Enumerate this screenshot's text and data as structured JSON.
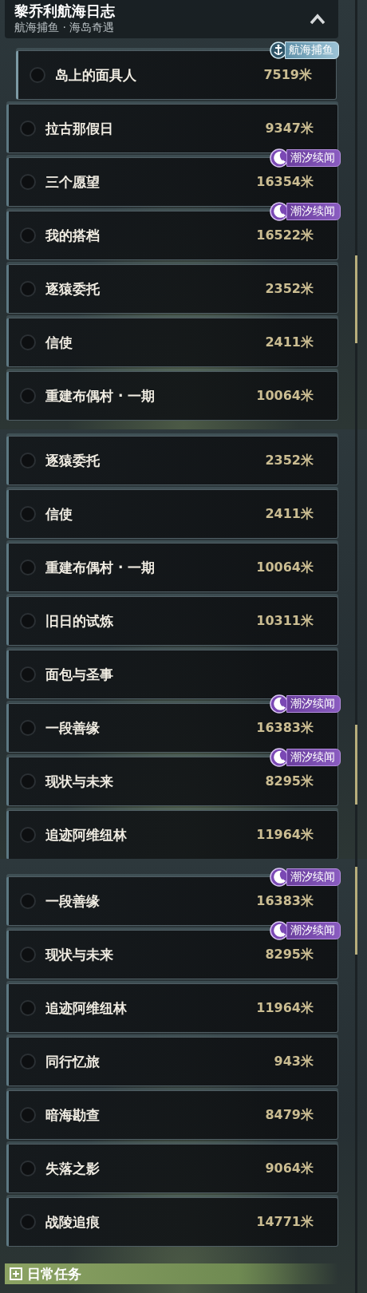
{
  "panels": [
    {
      "header": {
        "title": "黎乔利航海日志",
        "subtitle": "航海捕鱼 · 海岛奇遇",
        "expanded": true
      },
      "items": [
        {
          "kind": "sub",
          "name": "岛上的面具人",
          "distance": "7519米",
          "checked": false,
          "badge": {
            "kind": "fishing",
            "label": "航海捕鱼"
          }
        },
        {
          "kind": "task",
          "name": "拉古那假日",
          "distance": "9347米",
          "checked": false
        },
        {
          "kind": "task",
          "name": "三个愿望",
          "distance": "16354米",
          "checked": false,
          "badge": {
            "kind": "tide",
            "label": "潮汐续闻"
          }
        },
        {
          "kind": "task",
          "name": "我的搭档",
          "distance": "16522米",
          "checked": false,
          "badge": {
            "kind": "tide",
            "label": "潮汐续闻"
          }
        },
        {
          "kind": "task",
          "name": "逐猿委托",
          "distance": "2352米",
          "checked": false
        },
        {
          "kind": "task",
          "name": "信使",
          "distance": "2411米",
          "checked": false
        },
        {
          "kind": "task",
          "name": "重建布偶村 · 一期",
          "distance": "10064米",
          "checked": false
        }
      ]
    },
    {
      "items": [
        {
          "kind": "task",
          "name": "逐猿委托",
          "distance": "2352米",
          "checked": false
        },
        {
          "kind": "task",
          "name": "信使",
          "distance": "2411米",
          "checked": false
        },
        {
          "kind": "task",
          "name": "重建布偶村 · 一期",
          "distance": "10064米",
          "checked": false
        },
        {
          "kind": "task",
          "name": "旧日的试炼",
          "distance": "10311米",
          "checked": false
        },
        {
          "kind": "task",
          "name": "面包与圣事",
          "checked": false
        },
        {
          "kind": "task",
          "name": "一段善缘",
          "distance": "16383米",
          "checked": false,
          "badge": {
            "kind": "tide",
            "label": "潮汐续闻"
          }
        },
        {
          "kind": "task",
          "name": "现状与未来",
          "distance": "8295米",
          "checked": false,
          "badge": {
            "kind": "tide",
            "label": "潮汐续闻"
          }
        },
        {
          "kind": "task",
          "name": "追迹阿维纽林",
          "distance": "11964米",
          "checked": false
        }
      ]
    },
    {
      "items": [
        {
          "kind": "task",
          "name": "一段善缘",
          "distance": "16383米",
          "checked": false,
          "badge": {
            "kind": "tide",
            "label": "潮汐续闻"
          }
        },
        {
          "kind": "task",
          "name": "现状与未来",
          "distance": "8295米",
          "checked": false,
          "badge": {
            "kind": "tide",
            "label": "潮汐续闻"
          }
        },
        {
          "kind": "task",
          "name": "追迹阿维纽林",
          "distance": "11964米",
          "checked": false
        },
        {
          "kind": "task",
          "name": "同行忆旅",
          "distance": "943米",
          "checked": false
        },
        {
          "kind": "task",
          "name": "暗海勘查",
          "distance": "8479米",
          "checked": false
        },
        {
          "kind": "task",
          "name": "失落之影",
          "distance": "9064米",
          "checked": false
        },
        {
          "kind": "task",
          "name": "战陵追痕",
          "distance": "14771米",
          "checked": false
        }
      ],
      "footer": {
        "title": "日常任务",
        "expanded": false
      }
    }
  ]
}
